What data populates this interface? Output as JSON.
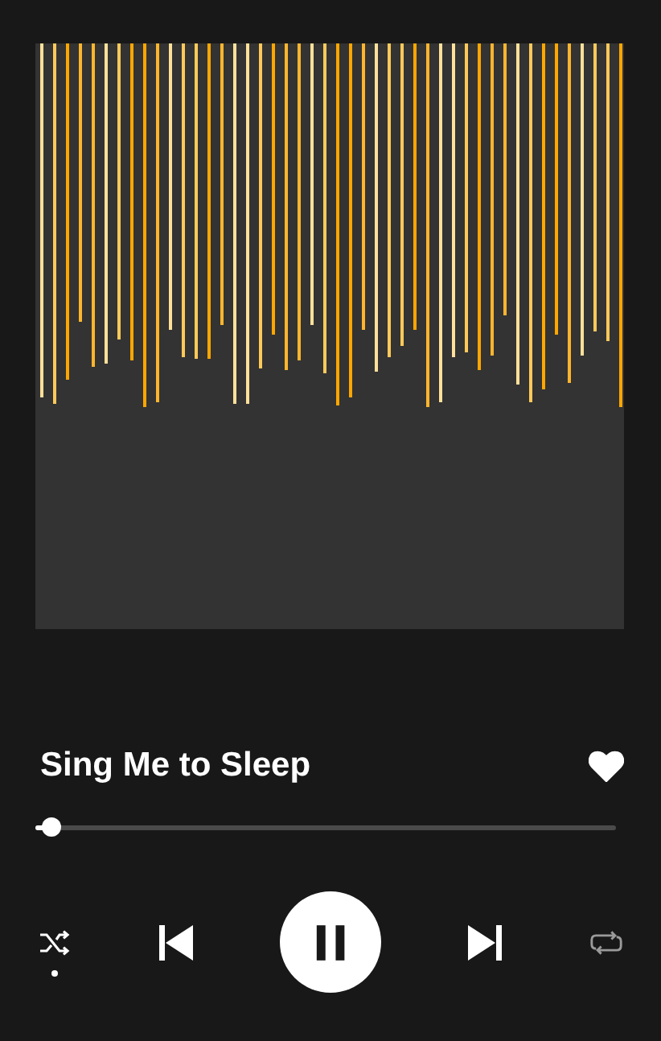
{
  "track": {
    "title": "Sing Me to Sleep",
    "liked": true
  },
  "progress": {
    "level": 0.02
  },
  "controls": {
    "shuffle": true,
    "repeat": false,
    "playing": true
  }
}
